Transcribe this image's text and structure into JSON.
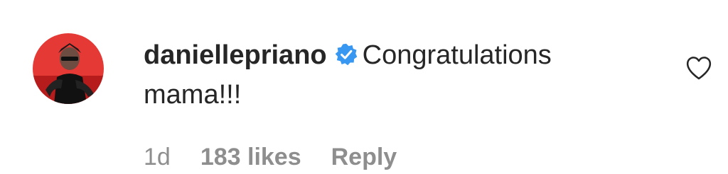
{
  "comment": {
    "username": "daniellepriano",
    "verified_icon": "verified-badge-icon",
    "text": "Congratulations mama!!!",
    "time": "1d",
    "likes": "183 likes",
    "reply_label": "Reply",
    "like_icon": "heart-outline-icon"
  },
  "colors": {
    "text": "#262626",
    "meta": "#8e8e8e",
    "verified": "#3897f0",
    "avatar_bg": "#e53935"
  }
}
